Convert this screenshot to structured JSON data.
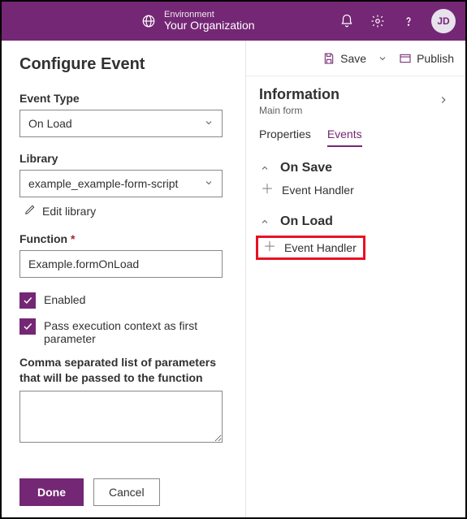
{
  "topbar": {
    "env_label": "Environment",
    "org_name": "Your Organization",
    "avatar_initials": "JD"
  },
  "left_panel": {
    "title": "Configure Event",
    "event_type_label": "Event Type",
    "event_type_value": "On Load",
    "library_label": "Library",
    "library_value": "example_example-form-script",
    "edit_library": "Edit library",
    "function_label": "Function",
    "function_value": "Example.formOnLoad",
    "enabled_label": "Enabled",
    "pass_context_label": "Pass execution context as first parameter",
    "params_label": "Comma separated list of parameters that will be passed to the function",
    "params_value": "",
    "done": "Done",
    "cancel": "Cancel"
  },
  "cmdbar": {
    "save": "Save",
    "publish": "Publish"
  },
  "right_panel": {
    "info_title": "Information",
    "info_subtitle": "Main form",
    "tab_properties": "Properties",
    "tab_events": "Events",
    "section_on_save": "On Save",
    "section_on_load": "On Load",
    "event_handler": "Event Handler"
  }
}
